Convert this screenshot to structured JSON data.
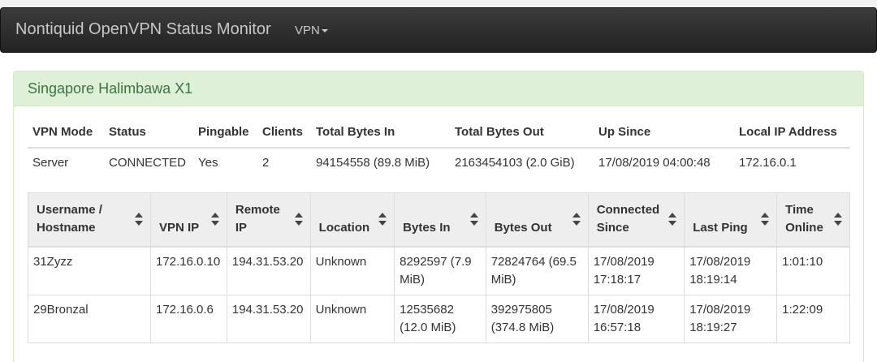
{
  "app": {
    "title": "Nontiquid OpenVPN Status Monitor",
    "menu_label": "VPN"
  },
  "panel": {
    "title": "Singapore Halimbawa X1"
  },
  "summary": {
    "headers": [
      "VPN Mode",
      "Status",
      "Pingable",
      "Clients",
      "Total Bytes In",
      "Total Bytes Out",
      "Up Since",
      "Local IP Address"
    ],
    "row": [
      "Server",
      "CONNECTED",
      "Yes",
      "2",
      "94154558 (89.8 MiB)",
      "2163454103 (2.0 GiB)",
      "17/08/2019 04:00:48",
      "172.16.0.1"
    ]
  },
  "clients": {
    "headers": [
      [
        "Username /",
        "Hostname"
      ],
      [
        "VPN IP"
      ],
      [
        "Remote",
        "IP"
      ],
      [
        "Location"
      ],
      [
        "Bytes In"
      ],
      [
        "Bytes Out"
      ],
      [
        "Connected",
        "Since"
      ],
      [
        "Last Ping"
      ],
      [
        "Time",
        "Online"
      ]
    ],
    "rows": [
      [
        [
          "31Zyzz"
        ],
        [
          "172.16.0.10"
        ],
        [
          "194.31.53.20"
        ],
        [
          "Unknown"
        ],
        [
          "8292597 (7.9",
          "MiB)"
        ],
        [
          "72824764 (69.5",
          "MiB)"
        ],
        [
          "17/08/2019",
          "17:18:17"
        ],
        [
          "17/08/2019",
          "18:19:14"
        ],
        [
          "1:01:10"
        ]
      ],
      [
        [
          "29Bronzal"
        ],
        [
          "172.16.0.6"
        ],
        [
          "194.31.53.20"
        ],
        [
          "Unknown"
        ],
        [
          "12535682",
          "(12.0 MiB)"
        ],
        [
          "392975805",
          "(374.8 MiB)"
        ],
        [
          "17/08/2019",
          "16:57:18"
        ],
        [
          "17/08/2019",
          "18:19:27"
        ],
        [
          "1:22:09"
        ]
      ]
    ]
  },
  "icons": {
    "sort": "sort-both-icon",
    "menu_caret": "caret-down-icon"
  },
  "colors": {
    "navbar": "#2b2b2b",
    "panel_heading_bg": "#dff0d8",
    "panel_heading_text": "#3c763d"
  }
}
